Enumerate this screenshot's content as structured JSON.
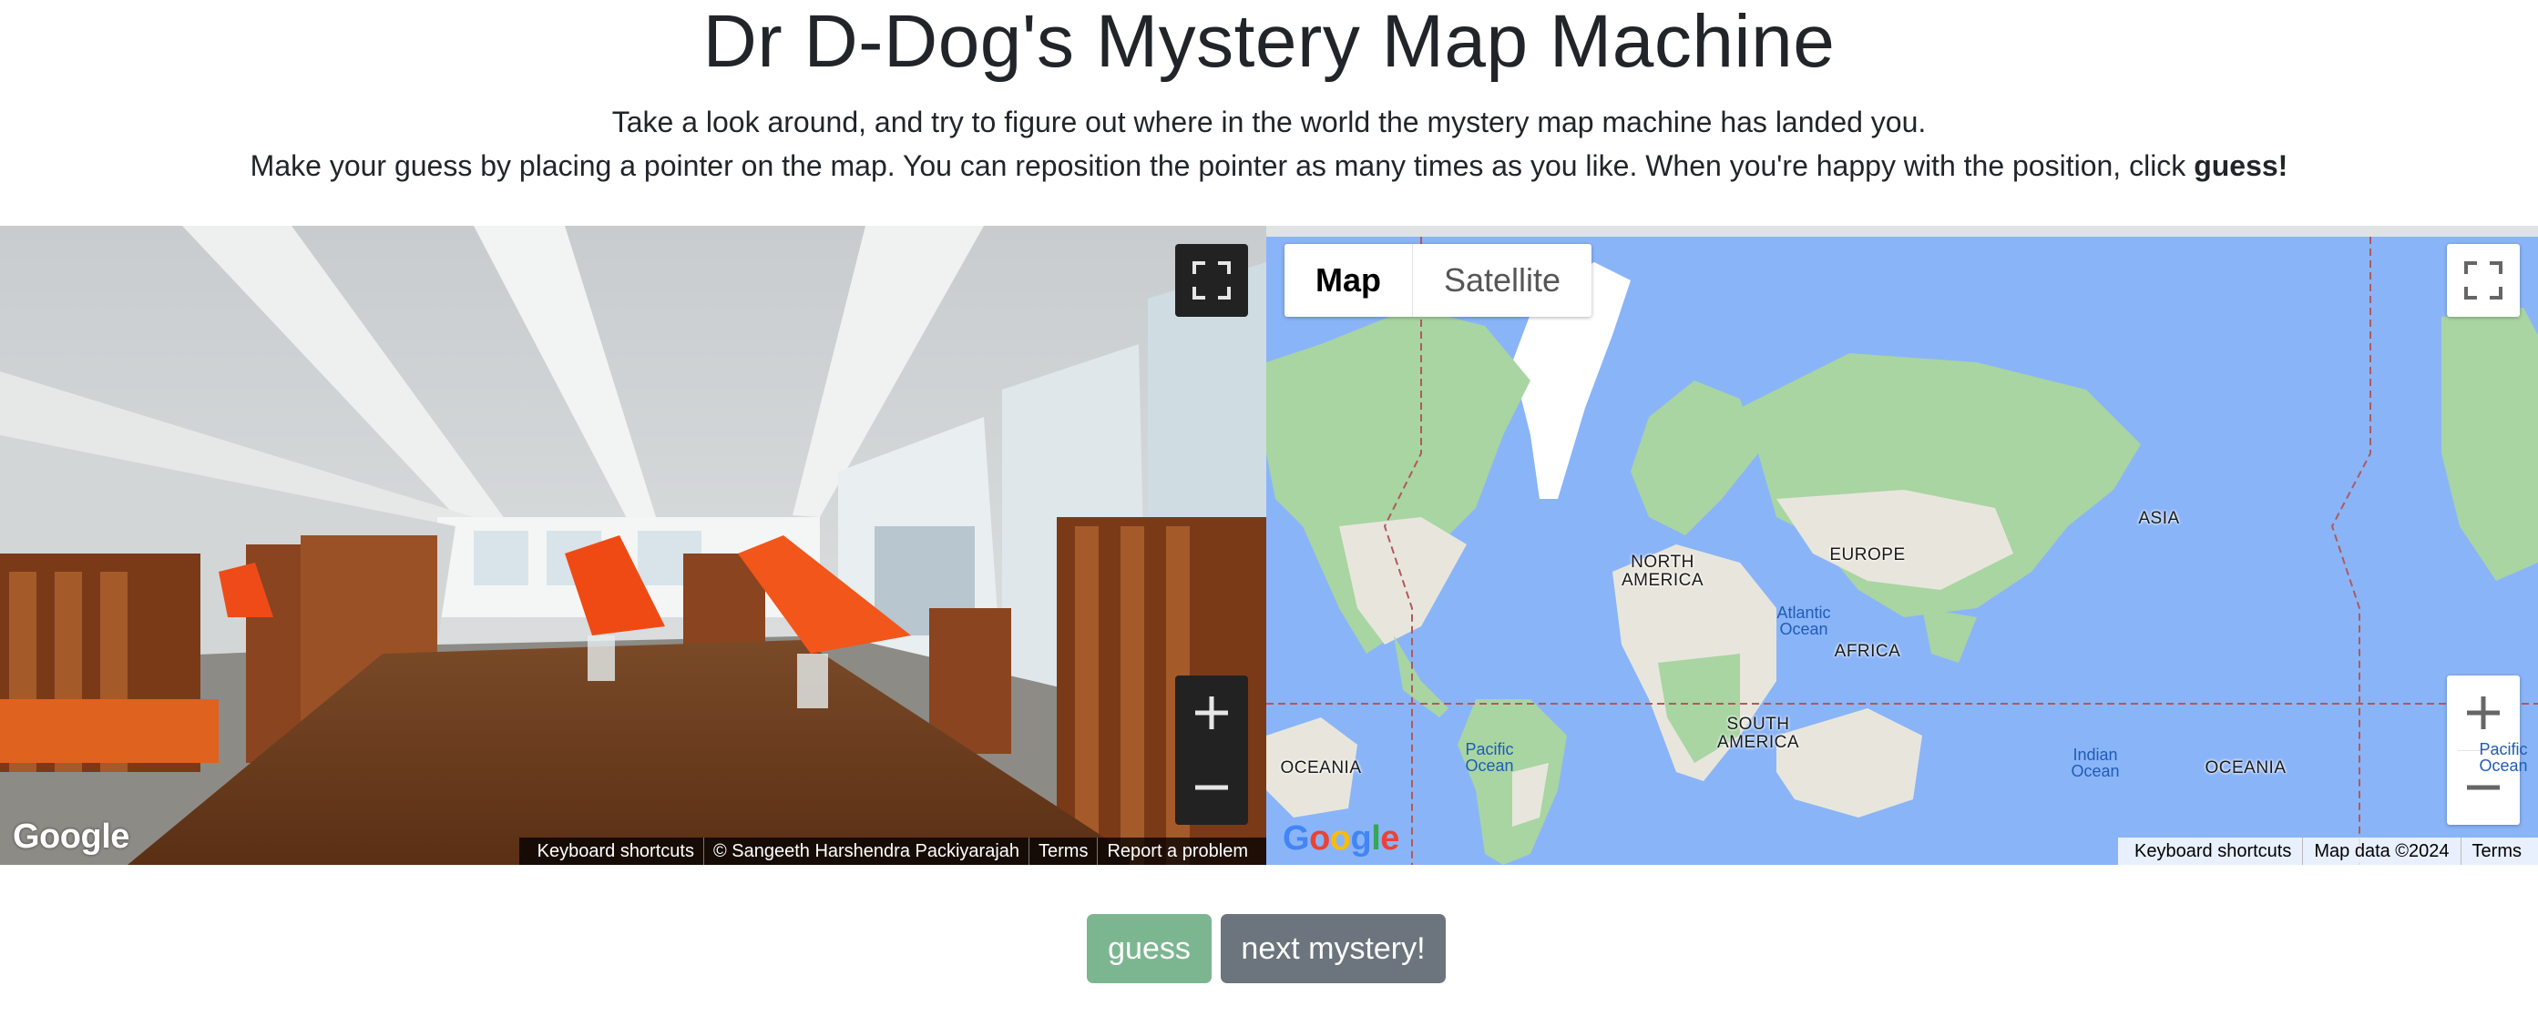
{
  "header": {
    "title": "Dr D-Dog's Mystery Map Machine",
    "line1": "Take a look around, and try to figure out where in the world the mystery map machine has landed you.",
    "line2_prefix": "Make your guess by placing a pointer on the map. You can reposition the pointer as many times as you like. When you're happy with the position, click ",
    "line2_bold": "guess!"
  },
  "streetview": {
    "logo": "Google",
    "attribution": [
      "Keyboard shortcuts",
      "© Sangeeth Harshendra Packiyarajah",
      "Terms",
      "Report a problem"
    ],
    "icons": {
      "fullscreen": "fullscreen-icon",
      "zoom_in": "plus-icon",
      "zoom_out": "minus-icon"
    }
  },
  "map": {
    "type_options": [
      "Map",
      "Satellite"
    ],
    "selected_type": "Map",
    "logo": "Google",
    "attribution": [
      "Keyboard shortcuts",
      "Map data ©2024",
      "Terms"
    ],
    "continent_labels": [
      "NORTH AMERICA",
      "SOUTH AMERICA",
      "EUROPE",
      "AFRICA",
      "ASIA",
      "OCEANIA",
      "OCEANIA"
    ],
    "ocean_labels": [
      "Atlantic Ocean",
      "Pacific Ocean",
      "Indian Ocean",
      "Pacific Ocean"
    ],
    "colors": {
      "water": "#8ab4f8",
      "land": "#e8e6dc",
      "vegetation": "#a8d5a2",
      "ice": "#ffffff"
    }
  },
  "actions": {
    "guess": "guess",
    "next": "next mystery!"
  },
  "colors": {
    "guess_button": "#7cb690",
    "next_button": "#6c757d"
  }
}
